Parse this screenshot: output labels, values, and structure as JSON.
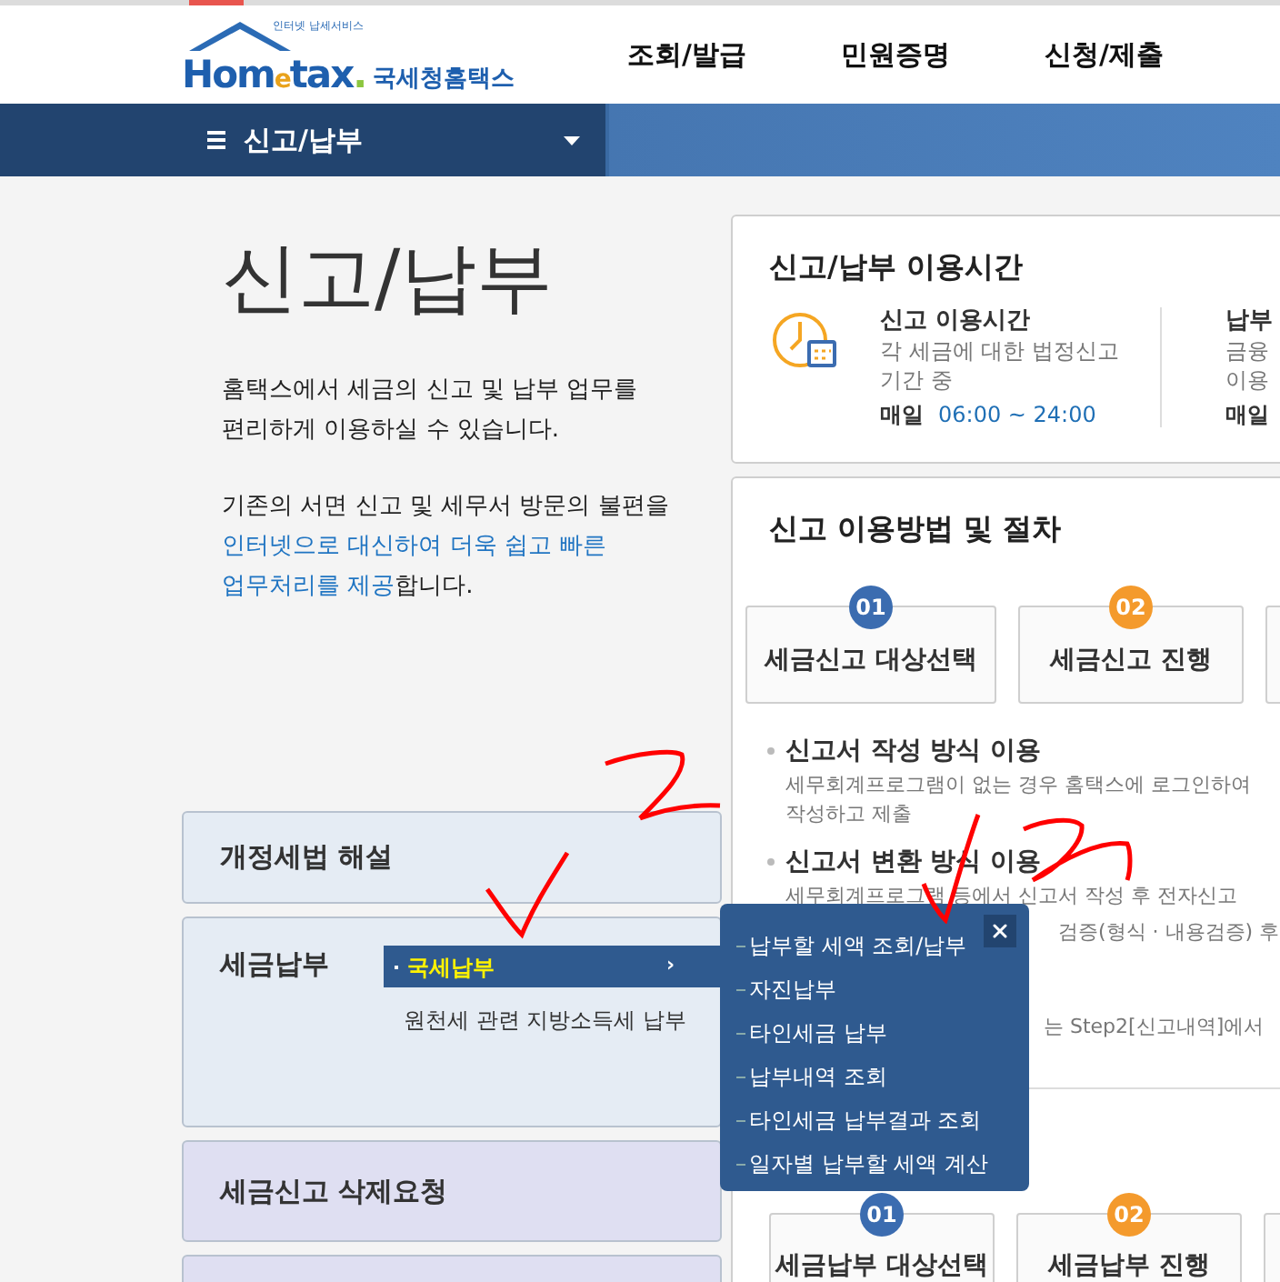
{
  "header": {
    "logo": {
      "tagline": "인터넷 납세서비스",
      "brand_a": "Hom",
      "brand_e": "e",
      "brand_b": "tax",
      "brand_dot": ".",
      "org": "국세청홈택스"
    },
    "nav": [
      "조회/발급",
      "민원증명",
      "신청/제출"
    ]
  },
  "breadcrumb": {
    "menu": "신고/납부"
  },
  "intro": {
    "title": "신고/납부",
    "para1": [
      "홈택스에서 세금의 신고 및 납부 업무를",
      "편리하게 이용하실 수 있습니다."
    ],
    "para2": {
      "before": "기존의 서면 신고 및 세무서 방문의 불편을",
      "highlight": "인터넷으로 대신하여 더욱 쉽고 빠른\n업무처리를 제공",
      "after": "합니다."
    }
  },
  "menu_cards": [
    {
      "label": "개정세법 해설",
      "kind": "plain",
      "color": "#e5ecf4"
    },
    {
      "label": "세금납부",
      "kind": "submenu",
      "color": "#e5ecf4",
      "items": [
        {
          "label": "국세납부",
          "selected": true,
          "arrow": "›"
        },
        {
          "label": "원천세 관련 지방소득세 납부",
          "selected": false
        }
      ]
    },
    {
      "label": "세금신고 삭제요청",
      "kind": "plain",
      "color": "#dfdff2"
    },
    {
      "kind": "cut",
      "color": "#dfdff2"
    }
  ],
  "flyout": {
    "items": [
      "납부할 세액 조회/납부",
      "자진납부",
      "타인세금 납부",
      "납부내역 조회",
      "타인세금 납부결과 조회",
      "일자별 납부할 세액 계산"
    ]
  },
  "time_card": {
    "title": "신고/납부 이용시간",
    "entries": [
      {
        "title": "신고 이용시간",
        "desc": [
          "각 세금에 대한 법정신고",
          "기간 중"
        ],
        "day": "매일",
        "hours": "06:00 ~ 24:00"
      },
      {
        "title": "납부",
        "desc": [
          "금융",
          "이용"
        ],
        "day": "매일"
      }
    ]
  },
  "procedure_card": {
    "title": "신고 이용방법 및 절차",
    "steps": [
      {
        "kind": "numbered",
        "num": "01",
        "label": "세금신고 대상선택",
        "color": "#3b6cb0"
      },
      {
        "kind": "numbered",
        "num": "02",
        "label": "세금신고 진행",
        "color": "#f49a2c"
      },
      {
        "kind": "cut"
      }
    ],
    "methods": [
      {
        "title": "신고서 작성 방식 이용",
        "lines": [
          "세무회계프로그램이 없는 경우 홈택스에 로그인하여",
          "작성하고 제출"
        ]
      },
      {
        "title": "신고서 변환 방식 이용",
        "lines": [
          "세무회계프로그램 등에서 신고서 작성 후 전자신고"
        ],
        "covered_line": "검증(형식 · 내용검증) 후"
      }
    ],
    "covered_note": "는 Step2[신고내역]에서",
    "pay_steps": [
      {
        "kind": "numbered",
        "num": "01",
        "label": "세금납부 대상선택",
        "color": "#3b6cb0"
      },
      {
        "kind": "numbered",
        "num": "02",
        "label": "세금납부 진행",
        "color": "#f49a2c"
      },
      {
        "kind": "cut"
      }
    ]
  }
}
